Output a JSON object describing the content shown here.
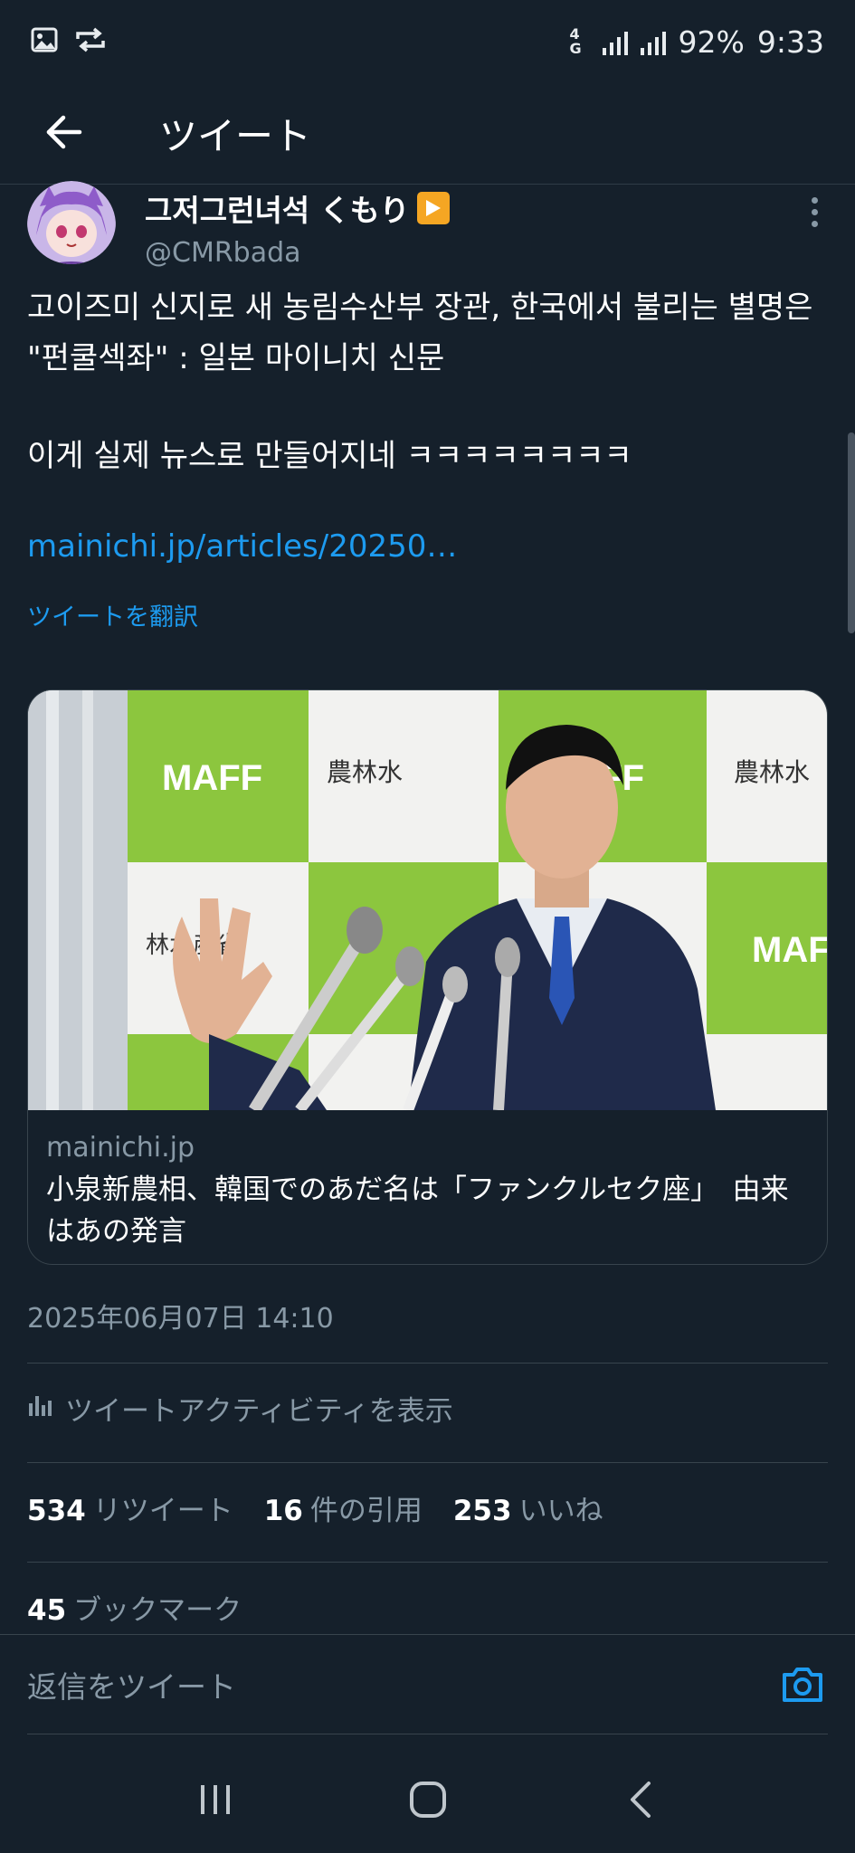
{
  "status_bar": {
    "network": "4G",
    "battery": "92%",
    "time": "9:33",
    "icons": [
      "gallery-icon",
      "sync-icon",
      "signal-icon",
      "signal-icon"
    ]
  },
  "header": {
    "back_icon": "arrow-left-icon",
    "title": "ツイート"
  },
  "tweet": {
    "author_name": "그저그런녀석 くもり",
    "author_badge": "play-badge",
    "author_handle": "@CMRbada",
    "body_line1": "고이즈미 신지로 새 농림수산부 장관, 한국에서 불리는 별명은 \"펀쿨섹좌\" : 일본 마이니치 신문",
    "body_line2": "이게 실제 뉴스로 만들어지네 ㅋㅋㅋㅋㅋㅋㅋㅋ",
    "link_text": "mainichi.jp/articles/20250…",
    "translate_label": "ツイートを翻訳",
    "card": {
      "domain": "mainichi.jp",
      "title": "小泉新農相、韓国でのあだ名は「ファンクルセク座」　由来はあの発言",
      "image_text_maff": "MAFF",
      "image_text_kanji1": "農林水",
      "image_text_kanji2": "林水産省"
    },
    "timestamp": "2025年06月07日 14:10",
    "activity_label": "ツイートアクティビティを表示",
    "stats": {
      "retweets_count": "534",
      "retweets_label": "リツイート",
      "quotes_count": "16",
      "quotes_label": "件の引用",
      "likes_count": "253",
      "likes_label": "いいね",
      "bookmarks_count": "45",
      "bookmarks_label": "ブックマーク"
    }
  },
  "reply": {
    "placeholder": "返信をツイート",
    "camera_icon": "camera-icon"
  },
  "navbar": {
    "recents_icon": "recents-icon",
    "home_icon": "home-icon",
    "back_icon": "back-icon"
  },
  "colors": {
    "background": "#15202b",
    "link": "#1d9bf0",
    "secondary": "#8899a6",
    "border": "#38444d"
  }
}
